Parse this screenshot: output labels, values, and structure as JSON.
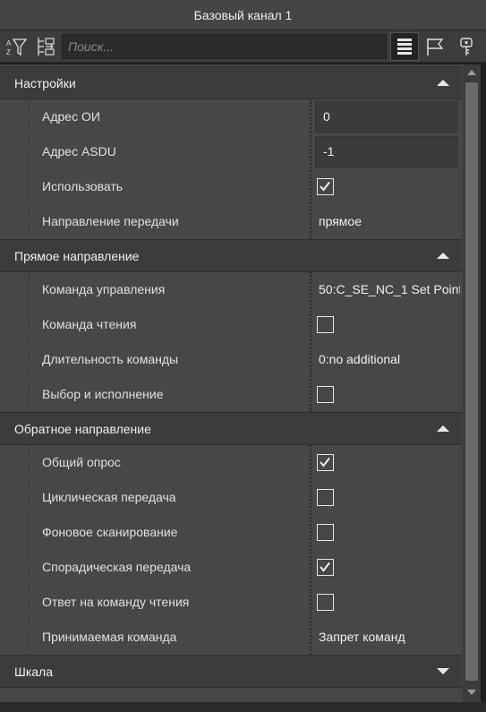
{
  "window": {
    "title": "Базовый канал 1"
  },
  "toolbar": {
    "search_placeholder": "Поиск...",
    "icons": [
      "sort-filter-icon",
      "tree-expand-icon",
      "list-view-icon",
      "flag-icon",
      "key-icon"
    ]
  },
  "sections": [
    {
      "title": "Настройки",
      "expanded": true,
      "rows": [
        {
          "label": "Адрес ОИ",
          "type": "input",
          "value": "0"
        },
        {
          "label": "Адрес ASDU",
          "type": "input",
          "value": "-1"
        },
        {
          "label": "Использовать",
          "type": "checkbox",
          "checked": true
        },
        {
          "label": "Направление передачи",
          "type": "text",
          "value": "прямое"
        }
      ]
    },
    {
      "title": "Прямое направление",
      "expanded": true,
      "rows": [
        {
          "label": "Команда управления",
          "type": "text",
          "value": "50:C_SE_NC_1 Set Point"
        },
        {
          "label": "Команда чтения",
          "type": "checkbox",
          "checked": false
        },
        {
          "label": "Длительность команды",
          "type": "text",
          "value": "0:no additional"
        },
        {
          "label": "Выбор и исполнение",
          "type": "checkbox",
          "checked": false
        }
      ]
    },
    {
      "title": "Обратное направление",
      "expanded": true,
      "rows": [
        {
          "label": "Общий опрос",
          "type": "checkbox",
          "checked": true
        },
        {
          "label": "Циклическая передача",
          "type": "checkbox",
          "checked": false
        },
        {
          "label": "Фоновое сканирование",
          "type": "checkbox",
          "checked": false
        },
        {
          "label": "Спорадическая передача",
          "type": "checkbox",
          "checked": true
        },
        {
          "label": "Ответ на команду чтения",
          "type": "checkbox",
          "checked": false
        },
        {
          "label": "Принимаемая команда",
          "type": "text",
          "value": "Запрет команд"
        }
      ]
    },
    {
      "title": "Шкала",
      "expanded": false,
      "rows": []
    }
  ],
  "colors": {
    "panel": "#474747",
    "header": "#3c3c3c",
    "title_bar": "#454545",
    "text": "#e6e6e6"
  }
}
